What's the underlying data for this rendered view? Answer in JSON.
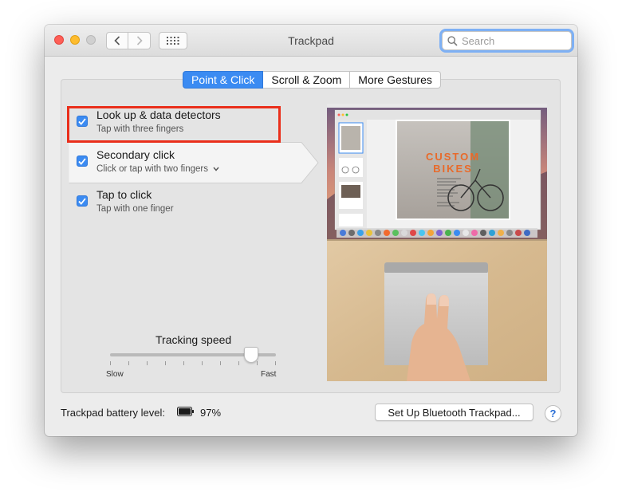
{
  "window": {
    "title": "Trackpad",
    "controls": {
      "close_color": "#fe5f57",
      "minimize_color": "#febc2e",
      "zoom_color": "#d0d0d0"
    },
    "nav": {
      "back_icon": "chevron-left-icon",
      "forward_icon": "chevron-right-icon",
      "show_all_icon": "grid-icon"
    }
  },
  "search": {
    "placeholder": "Search",
    "value": ""
  },
  "tabs": [
    {
      "label": "Point & Click",
      "active": true
    },
    {
      "label": "Scroll & Zoom",
      "active": false
    },
    {
      "label": "More Gestures",
      "active": false
    }
  ],
  "options": [
    {
      "title": "Look up & data detectors",
      "subtitle": "Tap with three fingers",
      "checked": true
    },
    {
      "title": "Secondary click",
      "subtitle": "Click or tap with two fingers",
      "subtitle_icon": "chevron-down-icon",
      "checked": true
    },
    {
      "title": "Tap to click",
      "subtitle": "Tap with one finger",
      "checked": true
    }
  ],
  "tracking": {
    "label": "Tracking speed",
    "min_label": "Slow",
    "max_label": "Fast",
    "value": 0.85,
    "ticks": 10
  },
  "preview": {
    "poster_title_line1": "CUSTOM",
    "poster_title_line2": "BIKES"
  },
  "footer": {
    "battery_label": "Trackpad battery level:",
    "battery_icon": "battery-icon",
    "battery_level": "97%",
    "setup_button": "Set Up Bluetooth Trackpad...",
    "help_button": "?"
  },
  "colors": {
    "accent": "#3b8bf2",
    "highlight": "#ea2f1b"
  }
}
